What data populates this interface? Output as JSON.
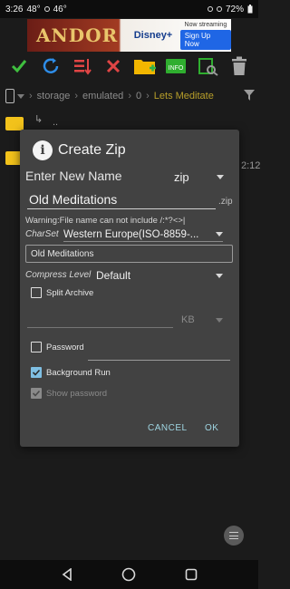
{
  "status_bar": {
    "time": "3:26",
    "temp1": "48°",
    "temp2": "46°",
    "battery": "72%"
  },
  "ad": {
    "title": "ANDOR",
    "brand": "Disney+",
    "now_streaming": "Now streaming",
    "cta": "Sign Up Now"
  },
  "colors": {
    "accent": "#9fd5e2",
    "checkbox": "#7fbfe3",
    "folder": "#f2c21b",
    "dialog_bg": "#424242"
  },
  "toolbar": {
    "icons": [
      "check-icon",
      "refresh-icon",
      "sort-icon",
      "close-icon",
      "add-folder-icon",
      "info-icon",
      "video-icon",
      "trash-icon"
    ]
  },
  "path": {
    "segments": [
      "storage",
      "emulated",
      "0"
    ],
    "current": "Lets Meditate"
  },
  "background": {
    "parent_label": "..",
    "time_label": "2:12"
  },
  "dialog": {
    "title": "Create Zip",
    "enter_name_label": "Enter New Name",
    "format": "zip",
    "name_value": "Old Meditations",
    "extension": ".zip",
    "warning": "Warning:File name can not include /:*?<>|",
    "charset_label": "CharSet",
    "charset_value": "Western Europe(ISO-8859-...",
    "charset_preview": "Old Meditations",
    "compress_label": "Compress Level",
    "compress_value": "Default",
    "split_archive_label": "Split Archive",
    "split_archive_checked": false,
    "size_unit": "KB",
    "password_label": "Password",
    "password_checked": false,
    "background_run_label": "Background Run",
    "background_run_checked": true,
    "show_password_label": "Show password",
    "show_password_checked": true,
    "cancel_label": "CANCEL",
    "ok_label": "OK"
  }
}
